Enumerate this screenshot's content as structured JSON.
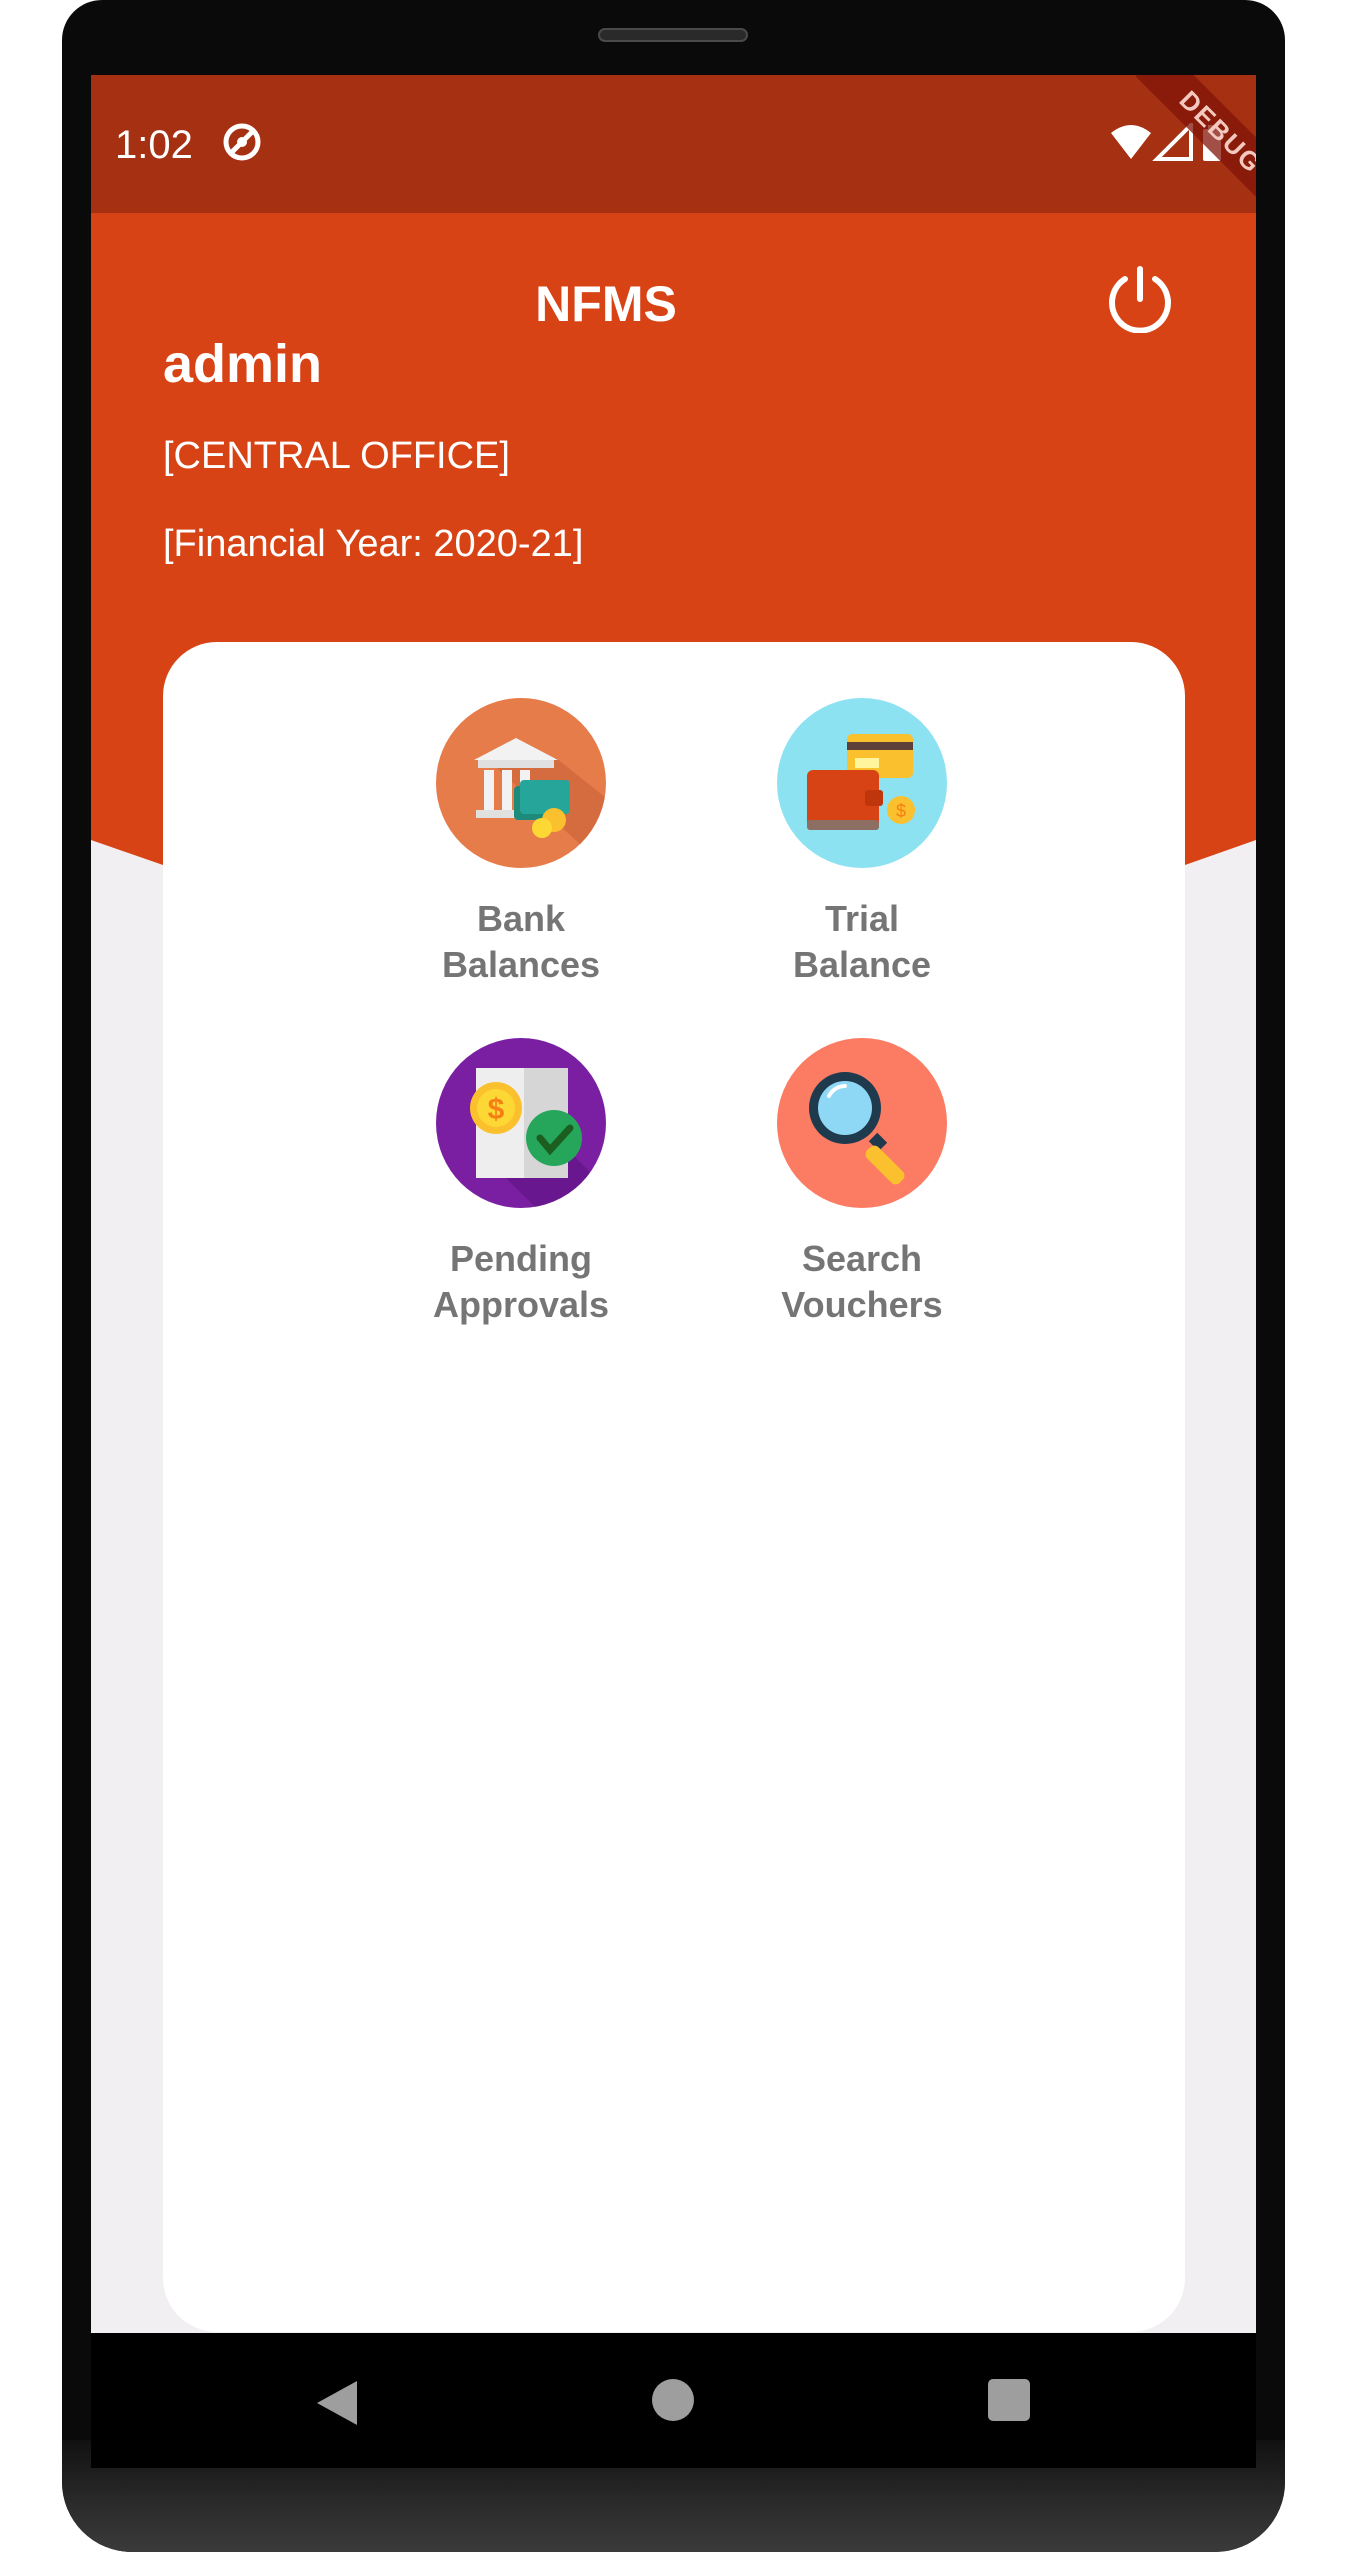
{
  "status_bar": {
    "time": "1:02",
    "sync_icon": "sync-disabled-icon",
    "wifi_icon": "wifi-icon",
    "signal_icon": "signal-icon",
    "battery_icon": "battery-icon",
    "debug_label": "DEBUG"
  },
  "header": {
    "title": "NFMS",
    "power_icon": "power-icon",
    "user": "admin",
    "office": "[CENTRAL OFFICE]",
    "financial_year": "[Financial Year: 2020-21]",
    "accent_color": "#d84315"
  },
  "menu": {
    "items": [
      {
        "line1": "Bank",
        "line2": "Balances",
        "icon": "bank-icon"
      },
      {
        "line1": "Trial",
        "line2": "Balance",
        "icon": "wallet-card-icon"
      },
      {
        "line1": "Pending",
        "line2": "Approvals",
        "icon": "approval-icon"
      },
      {
        "line1": "Search",
        "line2": "Vouchers",
        "icon": "magnifier-icon"
      }
    ]
  },
  "nav": {
    "back_icon": "back-icon",
    "home_icon": "home-icon",
    "recent_icon": "recent-apps-icon"
  }
}
